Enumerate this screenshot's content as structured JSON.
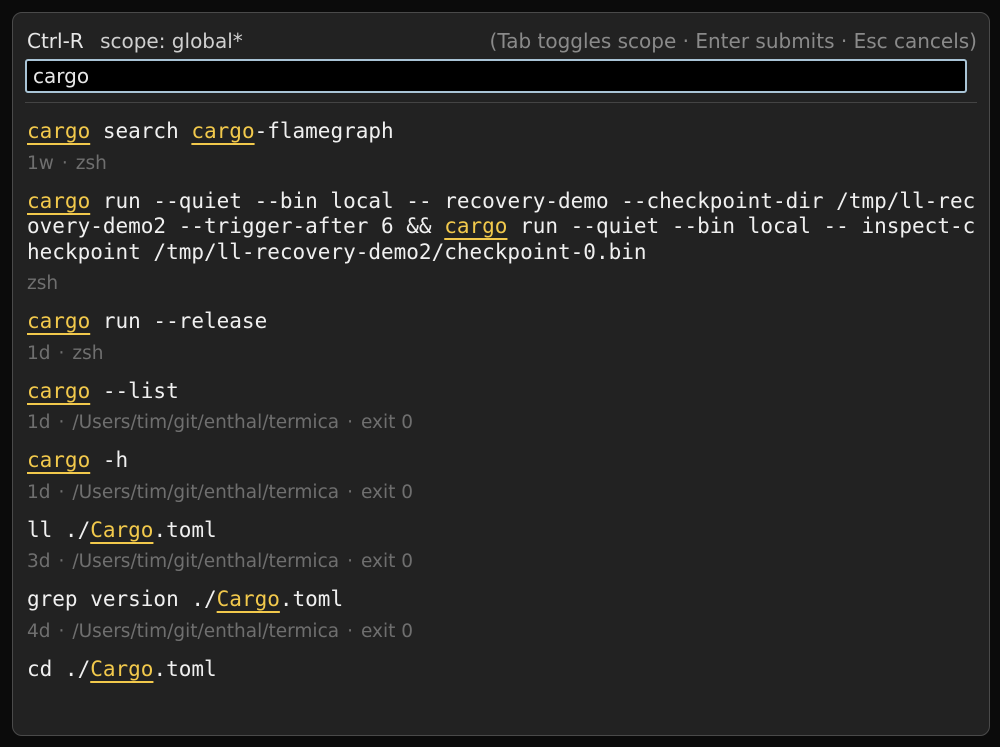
{
  "header": {
    "mode": "Ctrl-R",
    "scope": "scope: global*",
    "hint": "(Tab toggles scope · Enter submits · Esc cancels)"
  },
  "search": {
    "value": "cargo",
    "placeholder": ""
  },
  "meta_separator": "·",
  "results": [
    {
      "segments": [
        {
          "t": "cargo",
          "hl": true
        },
        {
          "t": " search ",
          "hl": false
        },
        {
          "t": "cargo",
          "hl": true
        },
        {
          "t": "-flamegraph",
          "hl": false
        }
      ],
      "meta": [
        "1w",
        "zsh"
      ]
    },
    {
      "segments": [
        {
          "t": "cargo",
          "hl": true
        },
        {
          "t": " run --quiet --bin local -- recovery-demo --checkpoint-dir /tmp/ll-recovery-demo2 --trigger-after 6 && ",
          "hl": false
        },
        {
          "t": "cargo",
          "hl": true
        },
        {
          "t": " run --quiet --bin local -- inspect-checkpoint /tmp/ll-recovery-demo2/checkpoint-0.bin",
          "hl": false
        }
      ],
      "meta": [
        "zsh"
      ]
    },
    {
      "segments": [
        {
          "t": "cargo",
          "hl": true
        },
        {
          "t": " run --release",
          "hl": false
        }
      ],
      "meta": [
        "1d",
        "zsh"
      ]
    },
    {
      "segments": [
        {
          "t": "cargo",
          "hl": true
        },
        {
          "t": " --list",
          "hl": false
        }
      ],
      "meta": [
        "1d",
        "/Users/tim/git/enthal/termica",
        "exit 0"
      ]
    },
    {
      "segments": [
        {
          "t": "cargo",
          "hl": true
        },
        {
          "t": " -h",
          "hl": false
        }
      ],
      "meta": [
        "1d",
        "/Users/tim/git/enthal/termica",
        "exit 0"
      ]
    },
    {
      "segments": [
        {
          "t": "ll ./",
          "hl": false
        },
        {
          "t": "Cargo",
          "hl": true
        },
        {
          "t": ".toml",
          "hl": false
        }
      ],
      "meta": [
        "3d",
        "/Users/tim/git/enthal/termica",
        "exit 0"
      ]
    },
    {
      "segments": [
        {
          "t": "grep version ./",
          "hl": false
        },
        {
          "t": "Cargo",
          "hl": true
        },
        {
          "t": ".toml",
          "hl": false
        }
      ],
      "meta": [
        "4d",
        "/Users/tim/git/enthal/termica",
        "exit 0"
      ]
    },
    {
      "segments": [
        {
          "t": "cd ./",
          "hl": false
        },
        {
          "t": "Cargo",
          "hl": true
        },
        {
          "t": ".toml",
          "hl": false
        }
      ],
      "meta": []
    }
  ]
}
